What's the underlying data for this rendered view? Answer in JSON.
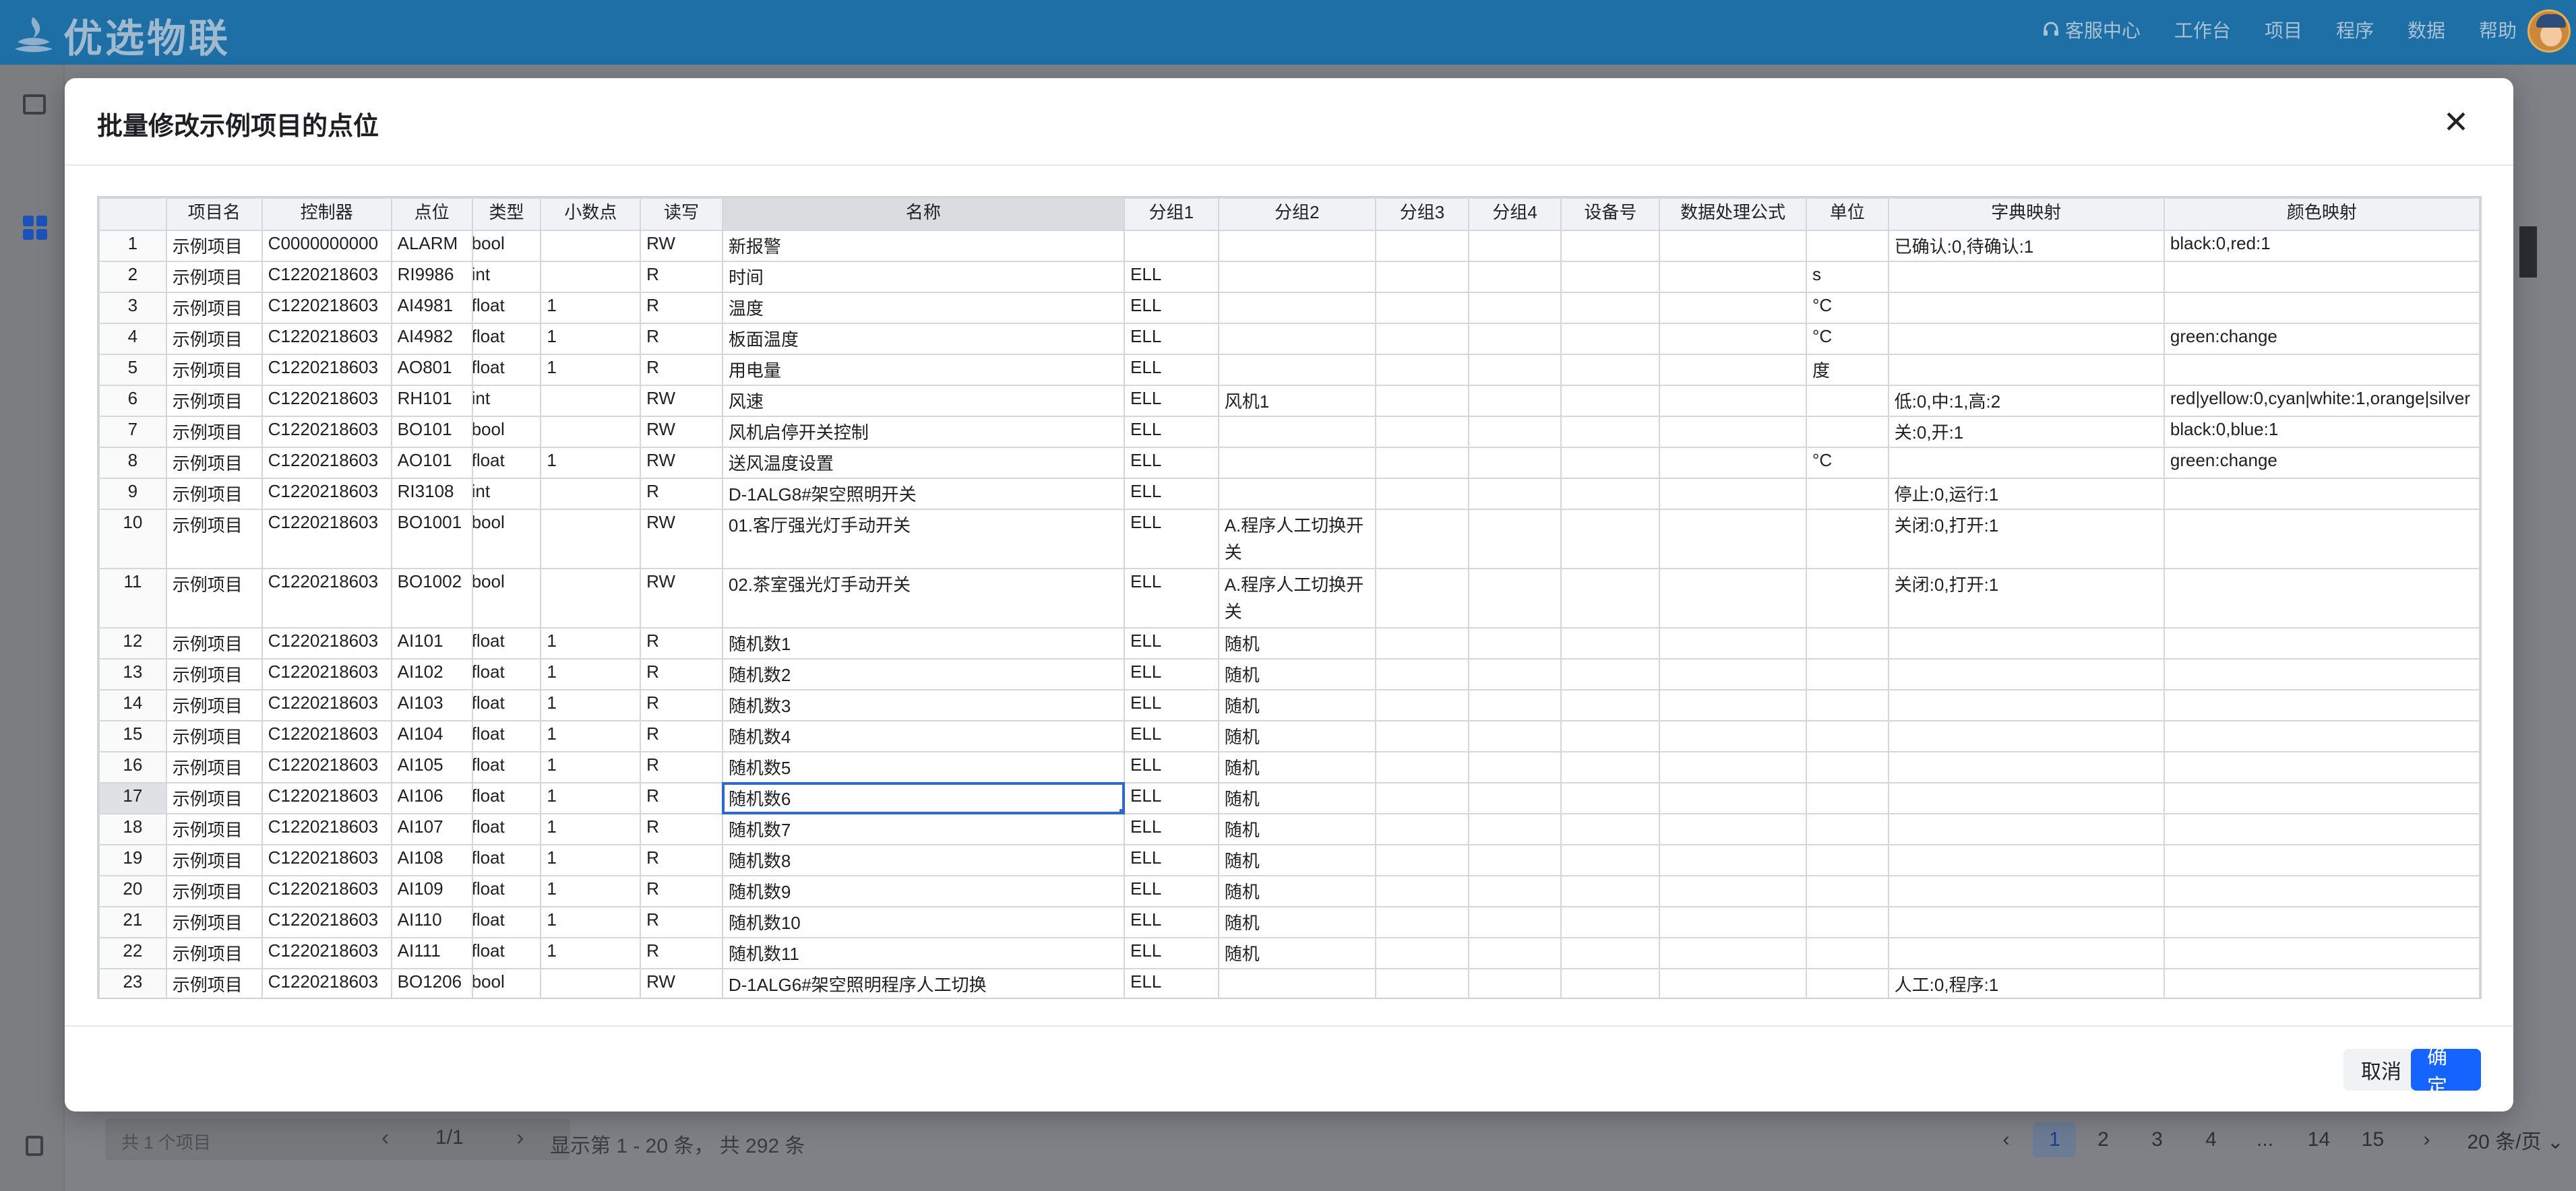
{
  "app": {
    "name": "优选物联"
  },
  "topnav": [
    "客服中心",
    "工作台",
    "项目",
    "程序",
    "数据",
    "帮助"
  ],
  "bottom": {
    "project_count": "共 1 个项目",
    "project_page": "1/1",
    "summary": "显示第 1 - 20 条， 共 292 条",
    "pages": [
      "1",
      "2",
      "3",
      "4",
      "...",
      "14",
      "15"
    ],
    "page_size": "20 条/页"
  },
  "modal": {
    "title": "批量修改示例项目的点位",
    "cancel": "取消",
    "ok": "确定"
  },
  "table": {
    "columns": [
      "",
      "项目名",
      "控制器",
      "点位",
      "类型",
      "小数点",
      "读写",
      "名称",
      "分组1",
      "分组2",
      "分组3",
      "分组4",
      "设备号",
      "数据处理公式",
      "单位",
      "字典映射",
      "颜色映射"
    ],
    "rows": [
      [
        "1",
        "示例项目",
        "C0000000000",
        "ALARM",
        "bool",
        "",
        "RW",
        "新报警",
        "",
        "",
        "",
        "",
        "",
        "",
        "",
        "已确认:0,待确认:1",
        "black:0,red:1"
      ],
      [
        "2",
        "示例项目",
        "C1220218603",
        "RI9986",
        "int",
        "",
        "R",
        "时间",
        "ELL",
        "",
        "",
        "",
        "",
        "",
        "s",
        "",
        ""
      ],
      [
        "3",
        "示例项目",
        "C1220218603",
        "AI4981",
        "float",
        "1",
        "R",
        "温度",
        "ELL",
        "",
        "",
        "",
        "",
        "",
        "°C",
        "",
        ""
      ],
      [
        "4",
        "示例项目",
        "C1220218603",
        "AI4982",
        "float",
        "1",
        "R",
        "板面温度",
        "ELL",
        "",
        "",
        "",
        "",
        "",
        "°C",
        "",
        "green:change"
      ],
      [
        "5",
        "示例项目",
        "C1220218603",
        "AO801",
        "float",
        "1",
        "R",
        "用电量",
        "ELL",
        "",
        "",
        "",
        "",
        "",
        "度",
        "",
        ""
      ],
      [
        "6",
        "示例项目",
        "C1220218603",
        "RH101",
        "int",
        "",
        "RW",
        "风速",
        "ELL",
        "风机1",
        "",
        "",
        "",
        "",
        "",
        "低:0,中:1,高:2",
        "red|yellow:0,cyan|white:1,orange|silver"
      ],
      [
        "7",
        "示例项目",
        "C1220218603",
        "BO101",
        "bool",
        "",
        "RW",
        "风机启停开关控制",
        "ELL",
        "",
        "",
        "",
        "",
        "",
        "",
        "关:0,开:1",
        "black:0,blue:1"
      ],
      [
        "8",
        "示例项目",
        "C1220218603",
        "AO101",
        "float",
        "1",
        "RW",
        "送风温度设置",
        "ELL",
        "",
        "",
        "",
        "",
        "",
        "°C",
        "",
        "green:change"
      ],
      [
        "9",
        "示例项目",
        "C1220218603",
        "RI3108",
        "int",
        "",
        "R",
        "D-1ALG8#架空照明开关",
        "ELL",
        "",
        "",
        "",
        "",
        "",
        "",
        "停止:0,运行:1",
        ""
      ],
      [
        "10",
        "示例项目",
        "C1220218603",
        "BO1001",
        "bool",
        "",
        "RW",
        "01.客厅强光灯手动开关",
        "ELL",
        "A.程序人工切换开关",
        "",
        "",
        "",
        "",
        "",
        "关闭:0,打开:1",
        ""
      ],
      [
        "11",
        "示例项目",
        "C1220218603",
        "BO1002",
        "bool",
        "",
        "RW",
        "02.茶室强光灯手动开关",
        "ELL",
        "A.程序人工切换开关",
        "",
        "",
        "",
        "",
        "",
        "关闭:0,打开:1",
        ""
      ],
      [
        "12",
        "示例项目",
        "C1220218603",
        "AI101",
        "float",
        "1",
        "R",
        "随机数1",
        "ELL",
        "随机",
        "",
        "",
        "",
        "",
        "",
        "",
        ""
      ],
      [
        "13",
        "示例项目",
        "C1220218603",
        "AI102",
        "float",
        "1",
        "R",
        "随机数2",
        "ELL",
        "随机",
        "",
        "",
        "",
        "",
        "",
        "",
        ""
      ],
      [
        "14",
        "示例项目",
        "C1220218603",
        "AI103",
        "float",
        "1",
        "R",
        "随机数3",
        "ELL",
        "随机",
        "",
        "",
        "",
        "",
        "",
        "",
        ""
      ],
      [
        "15",
        "示例项目",
        "C1220218603",
        "AI104",
        "float",
        "1",
        "R",
        "随机数4",
        "ELL",
        "随机",
        "",
        "",
        "",
        "",
        "",
        "",
        ""
      ],
      [
        "16",
        "示例项目",
        "C1220218603",
        "AI105",
        "float",
        "1",
        "R",
        "随机数5",
        "ELL",
        "随机",
        "",
        "",
        "",
        "",
        "",
        "",
        ""
      ],
      [
        "17",
        "示例项目",
        "C1220218603",
        "AI106",
        "float",
        "1",
        "R",
        "随机数6",
        "ELL",
        "随机",
        "",
        "",
        "",
        "",
        "",
        "",
        ""
      ],
      [
        "18",
        "示例项目",
        "C1220218603",
        "AI107",
        "float",
        "1",
        "R",
        "随机数7",
        "ELL",
        "随机",
        "",
        "",
        "",
        "",
        "",
        "",
        ""
      ],
      [
        "19",
        "示例项目",
        "C1220218603",
        "AI108",
        "float",
        "1",
        "R",
        "随机数8",
        "ELL",
        "随机",
        "",
        "",
        "",
        "",
        "",
        "",
        ""
      ],
      [
        "20",
        "示例项目",
        "C1220218603",
        "AI109",
        "float",
        "1",
        "R",
        "随机数9",
        "ELL",
        "随机",
        "",
        "",
        "",
        "",
        "",
        "",
        ""
      ],
      [
        "21",
        "示例项目",
        "C1220218603",
        "AI110",
        "float",
        "1",
        "R",
        "随机数10",
        "ELL",
        "随机",
        "",
        "",
        "",
        "",
        "",
        "",
        ""
      ],
      [
        "22",
        "示例项目",
        "C1220218603",
        "AI111",
        "float",
        "1",
        "R",
        "随机数11",
        "ELL",
        "随机",
        "",
        "",
        "",
        "",
        "",
        "",
        ""
      ],
      [
        "23",
        "示例项目",
        "C1220218603",
        "BO1206",
        "bool",
        "",
        "RW",
        "D-1ALG6#架空照明程序人工切换",
        "ELL",
        "",
        "",
        "",
        "",
        "",
        "",
        "人工:0,程序:1",
        ""
      ]
    ]
  },
  "colors": {
    "topbar": "#1d6fa5",
    "primary": "#1664ff",
    "selection": "#2a6ad8"
  }
}
